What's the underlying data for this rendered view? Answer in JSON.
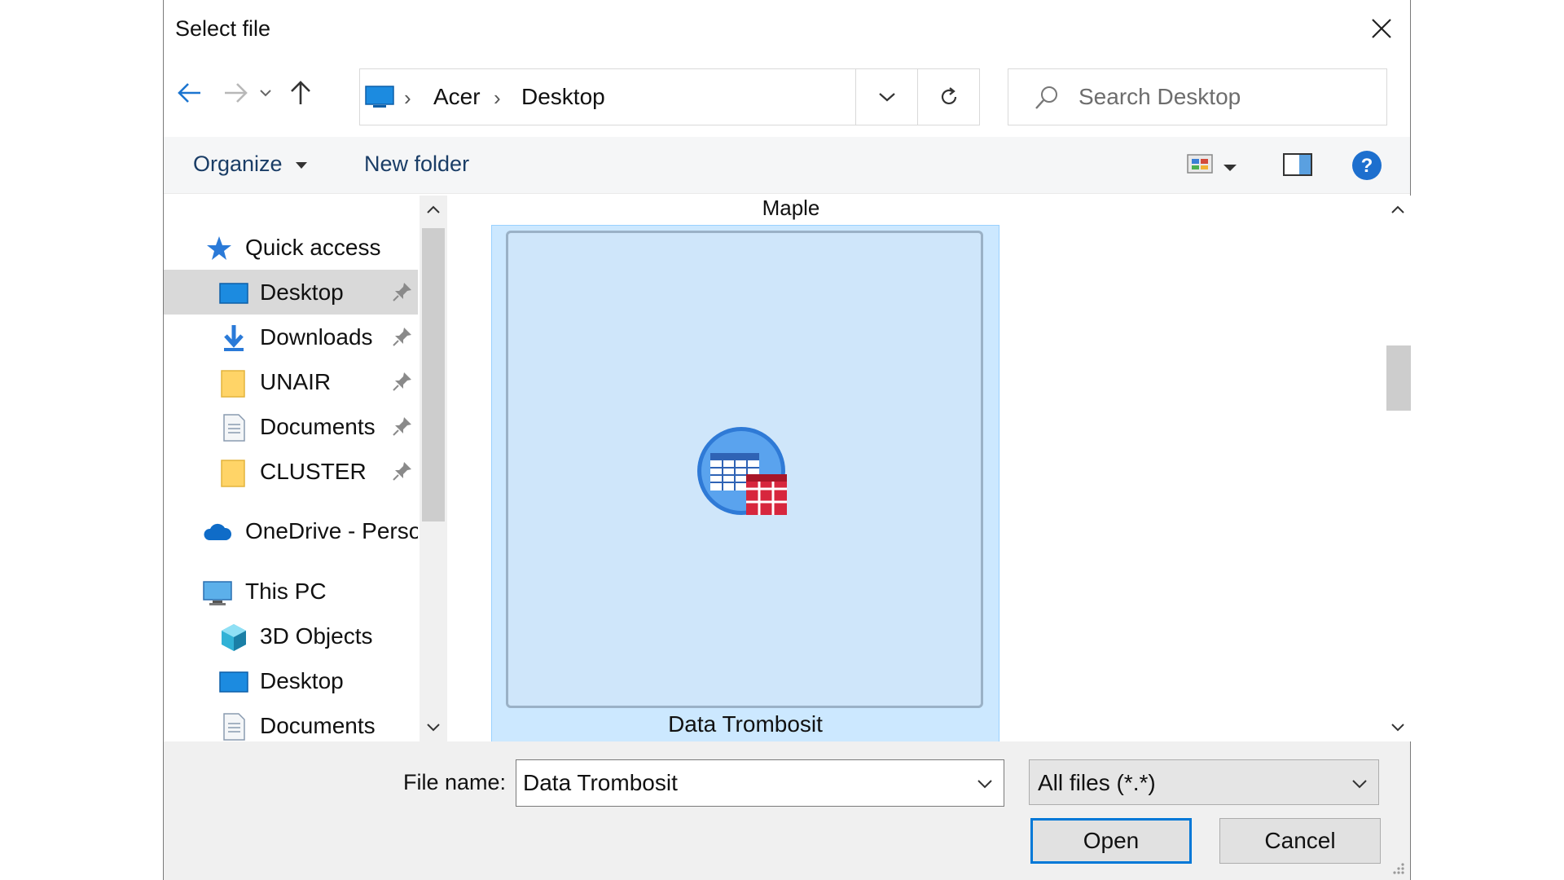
{
  "window": {
    "title": "Select file"
  },
  "address": {
    "crumbs": [
      "Acer",
      "Desktop"
    ]
  },
  "search": {
    "placeholder": "Search Desktop"
  },
  "toolbar": {
    "organize_label": "Organize",
    "new_folder_label": "New folder"
  },
  "nav": {
    "items": [
      {
        "label": "Quick access",
        "icon": "star-icon"
      },
      {
        "label": "Desktop",
        "icon": "desktop-icon",
        "pinned": true,
        "selected": true
      },
      {
        "label": "Downloads",
        "icon": "download-arrow-icon",
        "pinned": true
      },
      {
        "label": "UNAIR",
        "icon": "folder-icon",
        "pinned": true
      },
      {
        "label": "Documents",
        "icon": "document-icon",
        "pinned": true
      },
      {
        "label": "CLUSTER",
        "icon": "folder-icon",
        "pinned": true
      },
      {
        "label": "OneDrive - Persor",
        "icon": "cloud-icon"
      },
      {
        "label": "This PC",
        "icon": "computer-icon"
      },
      {
        "label": "3D Objects",
        "icon": "cube-icon"
      },
      {
        "label": "Desktop",
        "icon": "desktop-icon"
      },
      {
        "label": "Documents",
        "icon": "document-icon"
      }
    ]
  },
  "content": {
    "folder_caption": "Maple",
    "selected_file": "Data Trombosit",
    "file_icon": "spreadsheet-data-icon"
  },
  "footer": {
    "file_name_label": "File name:",
    "file_name_value": "Data Trombosit",
    "file_type_value": "All files (*.*)",
    "open_label": "Open",
    "cancel_label": "Cancel"
  },
  "colors": {
    "selection": "#cce8ff",
    "accent": "#0078d7",
    "nav_selected": "#d9d9d9"
  }
}
